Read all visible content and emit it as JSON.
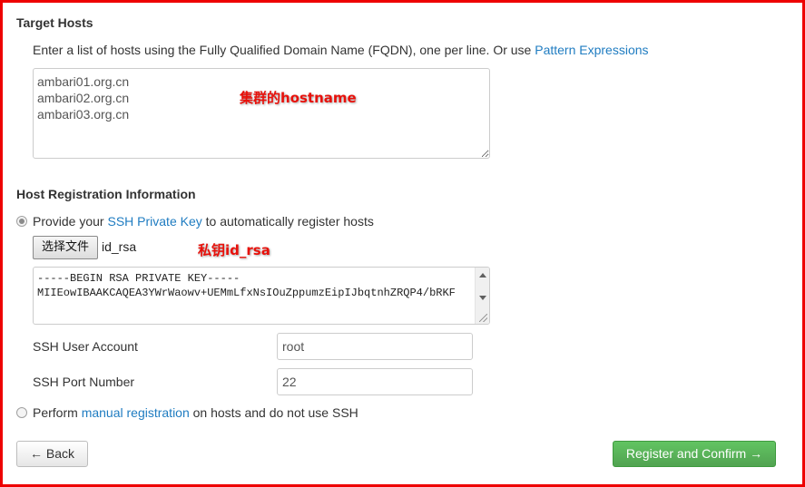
{
  "target_hosts": {
    "heading": "Target Hosts",
    "description": "Enter a list of hosts using the Fully Qualified Domain Name (FQDN), one per line. Or use ",
    "pattern_link": "Pattern Expressions",
    "hosts_value": "ambari01.org.cn\nambari02.org.cn\nambari03.org.cn",
    "annotation": "集群的hostname"
  },
  "registration": {
    "heading": "Host Registration Information",
    "option_ssh": {
      "prefix": "Provide your ",
      "link": "SSH Private Key",
      "suffix": " to automatically register hosts",
      "selected": true
    },
    "file_button_label": "选择文件",
    "file_name": "id_rsa",
    "file_annotation": "私钥id_rsa",
    "private_key_text": "-----BEGIN RSA PRIVATE KEY-----\nMIIEowIBAAKCAQEA3YWrWaowv+UEMmLfxNsIOuZppumzEipIJbqtnhZRQP4/bRKF",
    "ssh_user_label": "SSH User Account",
    "ssh_user_value": "root",
    "ssh_port_label": "SSH Port Number",
    "ssh_port_value": "22",
    "option_manual": {
      "prefix": "Perform ",
      "link": "manual registration",
      "suffix": " on hosts and do not use SSH",
      "selected": false
    }
  },
  "actions": {
    "back_label": "← Back",
    "register_label": "Register and Confirm →"
  },
  "colors": {
    "link": "#1f7cc1",
    "annotation": "#e8110b",
    "success": "#5bb75b",
    "frame": "#ee0000"
  }
}
